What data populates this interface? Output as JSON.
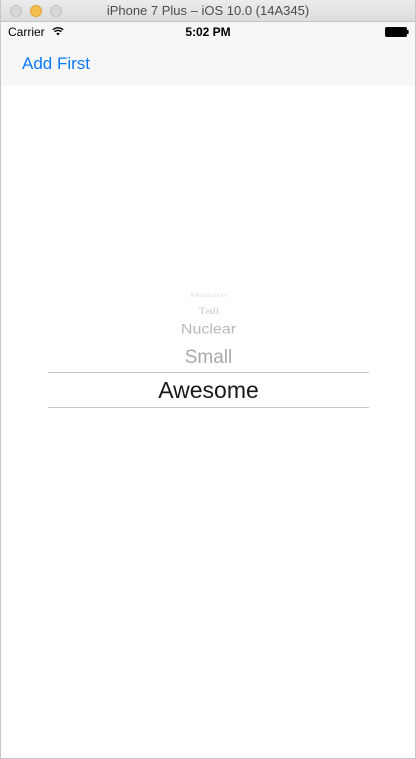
{
  "window": {
    "title": "iPhone 7 Plus – iOS 10.0 (14A345)"
  },
  "statusbar": {
    "carrier": "Carrier",
    "time": "5:02 PM",
    "wifi_icon": "wifi-icon",
    "battery_icon": "battery-icon"
  },
  "navbar": {
    "left_button": "Add First"
  },
  "picker": {
    "rows": [
      "Mature",
      "Tall",
      "Nuclear",
      "Small",
      "Awesome"
    ],
    "selected": "Awesome"
  }
}
